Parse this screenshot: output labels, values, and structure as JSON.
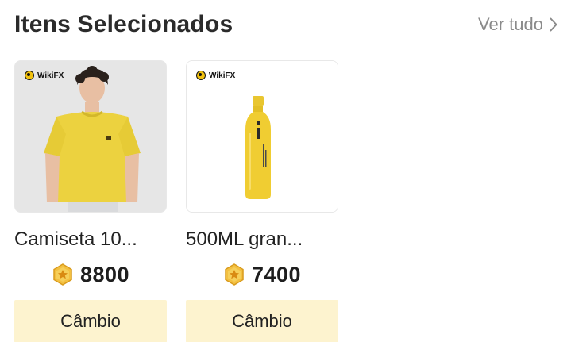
{
  "header": {
    "title": "Itens Selecionados",
    "see_all_label": "Ver tudo",
    "see_all_icon": "chevron-right-icon"
  },
  "products": [
    {
      "name": "Camiseta 10...",
      "brand": "WikiFX",
      "image": "yellow-tshirt-model",
      "price": "8800",
      "coin_icon": "star-coin-icon",
      "button_label": "Câmbio"
    },
    {
      "name": "500ML gran...",
      "brand": "WikiFX",
      "image": "yellow-water-bottle",
      "price": "7400",
      "coin_icon": "star-coin-icon",
      "button_label": "Câmbio"
    }
  ],
  "colors": {
    "accent_yellow": "#f2c20f",
    "button_bg": "#fdf3cf",
    "muted_text": "#8a8a8a"
  }
}
